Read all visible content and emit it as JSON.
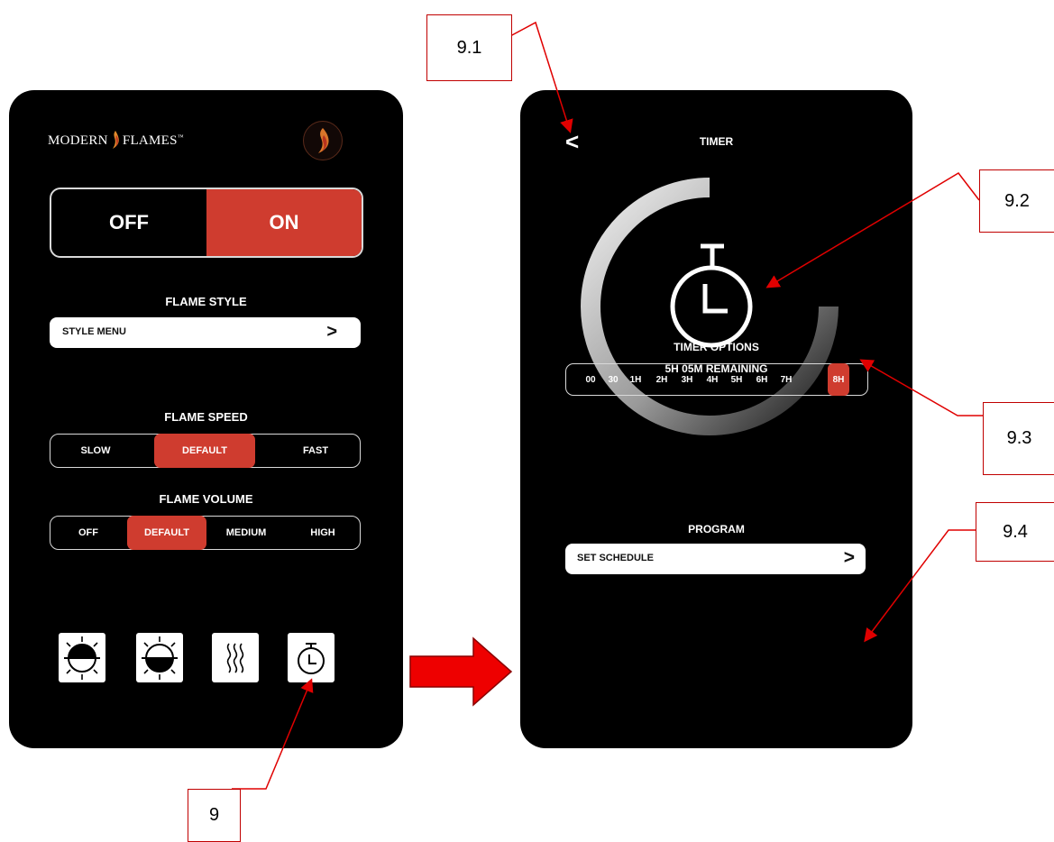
{
  "left_screen": {
    "brand": {
      "prefix": "MODERN",
      "suffix": "FLAMES",
      "mark": "™"
    },
    "power": {
      "off_label": "OFF",
      "on_label": "ON",
      "selected": "ON"
    },
    "flame_style": {
      "title": "FLAME STYLE",
      "button_label": "STYLE MENU",
      "chevron": ">"
    },
    "flame_speed": {
      "title": "FLAME SPEED",
      "options": [
        "SLOW",
        "DEFAULT",
        "FAST"
      ],
      "selected": "DEFAULT"
    },
    "flame_volume": {
      "title": "FLAME VOLUME",
      "options": [
        "OFF",
        "DEFAULT",
        "MEDIUM",
        "HIGH"
      ],
      "selected": "DEFAULT"
    },
    "bottom_icons": [
      "brightness-top-icon",
      "brightness-bottom-icon",
      "heat-icon",
      "timer-icon"
    ]
  },
  "right_screen": {
    "back": "<",
    "title": "TIMER",
    "remaining": "5H 05M REMAINING",
    "timer_options": {
      "title": "TIMER OPTIONS",
      "options": [
        "00",
        "30",
        "1H",
        "2H",
        "3H",
        "4H",
        "5H",
        "6H",
        "7H",
        "8H"
      ],
      "selected": "8H"
    },
    "program": {
      "title": "PROGRAM",
      "button_label": "SET SCHEDULE",
      "chevron": ">"
    }
  },
  "callouts": {
    "c9": "9",
    "c91": "9.1",
    "c92": "9.2",
    "c93": "9.3",
    "c94": "9.4"
  },
  "colors": {
    "accent": "#cf3c2f",
    "annotation": "#e00000",
    "arrow_fill": "#ee0000"
  }
}
